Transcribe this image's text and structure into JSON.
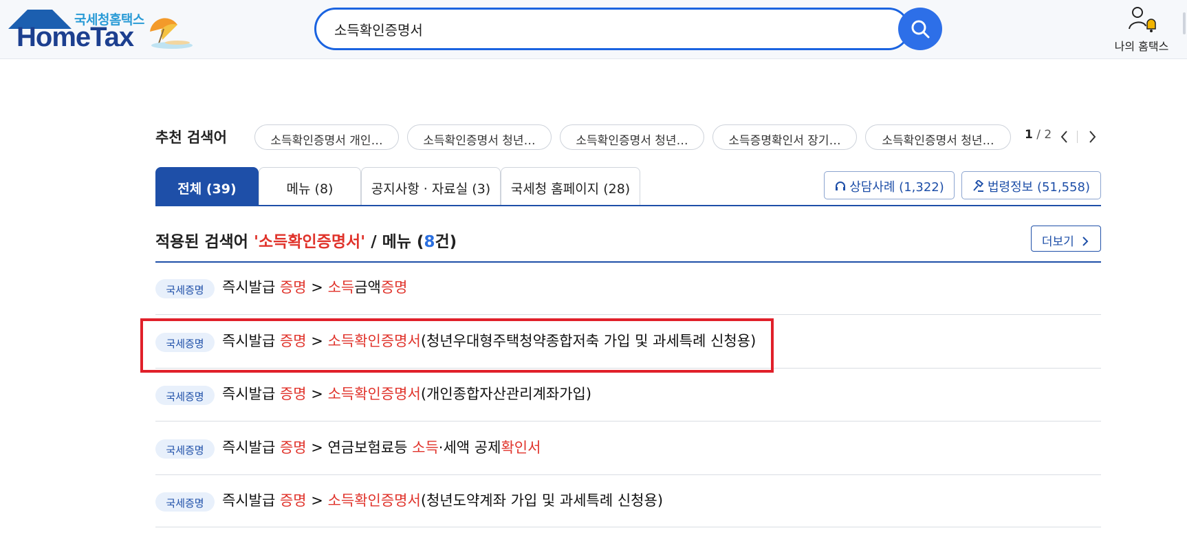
{
  "header": {
    "logo_sub": "국세청홈택스",
    "logo_main": "HomeTax",
    "search_value": "소득확인증명서",
    "my_hometax_label": "나의 홈택스"
  },
  "recommended": {
    "title": "추천 검색어",
    "chips": [
      "소득확인증명서 개인…",
      "소득확인증명서 청년…",
      "소득확인증명서 청년…",
      "소득증명확인서 장기…",
      "소득확인증명서 청년…"
    ],
    "page_current": "1",
    "page_total": "/ 2"
  },
  "tabs": [
    {
      "label": "전체 (39)",
      "active": true
    },
    {
      "label": "메뉴 (8)",
      "active": false
    },
    {
      "label": "공지사항 · 자료실 (3)",
      "active": false
    },
    {
      "label": "국세청 홈페이지 (28)",
      "active": false
    }
  ],
  "side_buttons": {
    "consult": "상담사례 (1,322)",
    "law": "법령정보 (51,558)"
  },
  "results_header": {
    "prefix": "적용된 검색어 ",
    "keyword": "'소득확인증명서'",
    "middle": " / 메뉴 (",
    "count": "8",
    "suffix": "건)",
    "more_label": "더보기"
  },
  "results": [
    {
      "badge": "국세증명",
      "parts": [
        [
          "즉시발급 ",
          false
        ],
        [
          "증명",
          true
        ],
        [
          " > ",
          false
        ],
        [
          "소득",
          true
        ],
        [
          "금액",
          false
        ],
        [
          "증명",
          true
        ]
      ]
    },
    {
      "badge": "국세증명",
      "parts": [
        [
          "즉시발급 ",
          false
        ],
        [
          "증명",
          true
        ],
        [
          " > ",
          false
        ],
        [
          "소득확인증명서",
          true
        ],
        [
          "(청년우대형주택청약종합저축 가입 및 과세특례 신청용)",
          false
        ]
      ]
    },
    {
      "badge": "국세증명",
      "parts": [
        [
          "즉시발급 ",
          false
        ],
        [
          "증명",
          true
        ],
        [
          " > ",
          false
        ],
        [
          "소득확인증명서",
          true
        ],
        [
          "(개인종합자산관리계좌가입)",
          false
        ]
      ]
    },
    {
      "badge": "국세증명",
      "parts": [
        [
          "즉시발급 ",
          false
        ],
        [
          "증명",
          true
        ],
        [
          " > 연금보험료등 ",
          false
        ],
        [
          "소득",
          true
        ],
        [
          "·세액 공제",
          false
        ],
        [
          "확인서",
          true
        ]
      ]
    },
    {
      "badge": "국세증명",
      "parts": [
        [
          "즉시발급 ",
          false
        ],
        [
          "증명",
          true
        ],
        [
          " > ",
          false
        ],
        [
          "소득확인증명서",
          true
        ],
        [
          "(청년도약계좌 가입 및 과세특례 신청용)",
          false
        ]
      ]
    }
  ],
  "colors": {
    "primary": "#1e4fa8",
    "search_accent": "#2d6fe8",
    "keyword_red": "#e0332b",
    "highlight_box": "#e0202a"
  }
}
